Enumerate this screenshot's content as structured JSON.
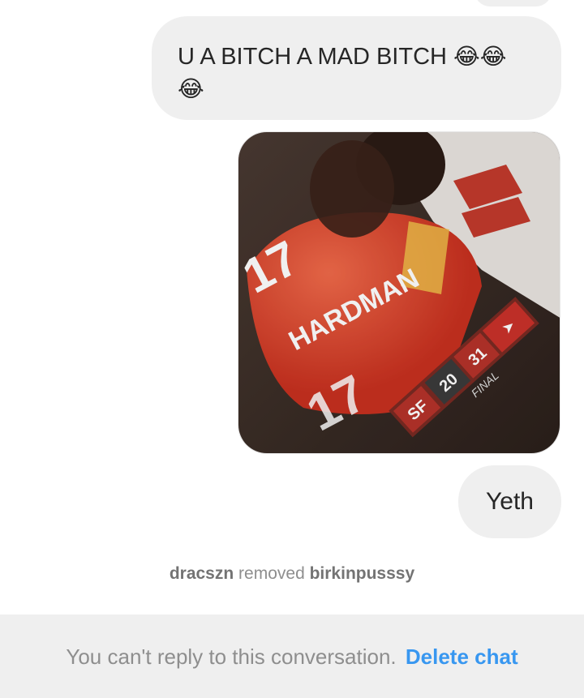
{
  "messages": [
    {
      "text": "U A BITCH A MAD BITCH ",
      "emojis": [
        "😂",
        "😂",
        "😂"
      ]
    },
    {
      "text": "Yeth"
    }
  ],
  "photo": {
    "jersey_name": "HARDMAN",
    "jersey_number": "17",
    "score": {
      "home": "20",
      "away": "31",
      "status": "FINAL",
      "home_logo": "SF"
    },
    "colors": {
      "jersey_red": "#d63a26",
      "jersey_stripe": "#f0c34a",
      "background": "#3a2a24",
      "score_bar": "#b5322a"
    }
  },
  "system_note": {
    "actor": "dracszn",
    "action": "removed",
    "target": "birkinpusssy"
  },
  "footer": {
    "notice": "You can't reply to this conversation.",
    "action_label": "Delete chat"
  },
  "colors": {
    "bubble": "#efefef",
    "link": "#3897f0",
    "muted": "#8e8e8e"
  }
}
